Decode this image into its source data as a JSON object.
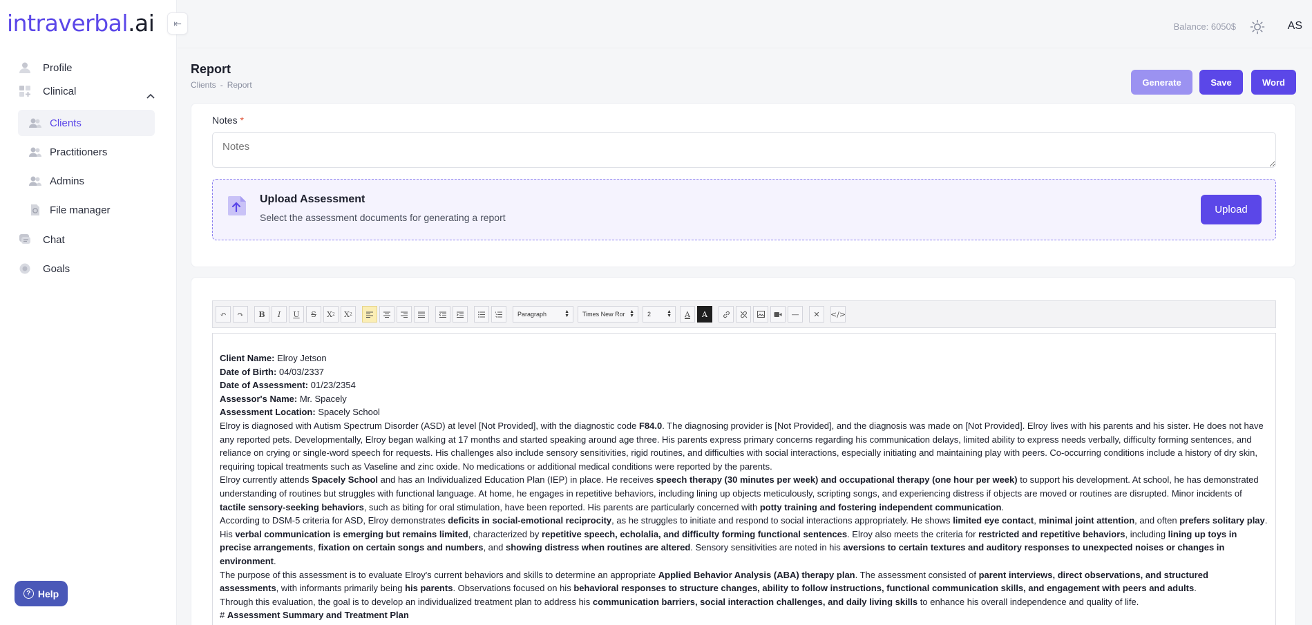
{
  "logo": {
    "main": "intraverbal",
    "suffix": ".ai"
  },
  "sidebar": {
    "collapse_glyph": "⇤",
    "profile": "Profile",
    "clinical": "Clinical",
    "clients": "Clients",
    "practitioners": "Practitioners",
    "admins": "Admins",
    "file_manager": "File manager",
    "chat": "Chat",
    "goals": "Goals",
    "help": "Help"
  },
  "topbar": {
    "balance": "Balance: 6050$",
    "initials": "AS",
    "theme_icon": "sun-icon"
  },
  "header": {
    "title": "Report",
    "breadcrumb": [
      "Clients",
      "-",
      "Report"
    ],
    "generate": "Generate",
    "save": "Save",
    "word": "Word"
  },
  "notes": {
    "label": "Notes",
    "required_mark": "*",
    "placeholder": "Notes",
    "value": ""
  },
  "upload": {
    "title": "Upload Assessment",
    "subtitle": "Select the assessment documents for generating a report",
    "button": "Upload"
  },
  "toolbar": {
    "block_format": "Paragraph",
    "font_family": "Times New Ror",
    "font_size": "2"
  },
  "document": {
    "client_name_label": "Client Name:",
    "client_name": "Elroy Jetson",
    "dob_label": "Date of Birth:",
    "dob": "04/03/2337",
    "doa_label": "Date of Assessment:",
    "doa": "01/23/2354",
    "assessor_label": "Assessor's Name:",
    "assessor": "Mr. Spacely",
    "location_label": "Assessment Location:",
    "location": "Spacely School",
    "p1": [
      {
        "t": "Elroy is diagnosed with Autism Spectrum Disorder (ASD) at level [Not Provided], with the diagnostic code ",
        "b": false
      },
      {
        "t": "F84.0",
        "b": true
      },
      {
        "t": ". The diagnosing provider is [Not Provided], and the diagnosis was made on [Not Provided]. Elroy lives with his parents and his sister. He does not have any reported pets. Developmentally, Elroy began walking at 17 months and started speaking around age three. His parents express primary concerns regarding his communication delays, limited ability to express needs verbally, difficulty forming sentences, and reliance on crying or single-word speech for requests. His challenges also include sensory sensitivities, rigid routines, and difficulties with social interactions, especially initiating and maintaining play with peers. Co-occurring conditions include a history of dry skin, requiring topical treatments such as Vaseline and zinc oxide. No medications or additional medical conditions were reported by the parents.",
        "b": false
      }
    ],
    "p2": [
      {
        "t": "Elroy currently attends ",
        "b": false
      },
      {
        "t": "Spacely School",
        "b": true
      },
      {
        "t": " and has an Individualized Education Plan (IEP) in place. He receives ",
        "b": false
      },
      {
        "t": "speech therapy (30 minutes per week) and occupational therapy (one hour per week)",
        "b": true
      },
      {
        "t": " to support his development. At school, he has demonstrated understanding of routines but struggles with functional language. At home, he engages in repetitive behaviors, including lining up objects meticulously, scripting songs, and experiencing distress if objects are moved or routines are disrupted. Minor incidents of ",
        "b": false
      },
      {
        "t": "tactile sensory-seeking behaviors",
        "b": true
      },
      {
        "t": ", such as biting for oral stimulation, have been reported. His parents are particularly concerned with ",
        "b": false
      },
      {
        "t": "potty training and fostering independent communication",
        "b": true
      },
      {
        "t": ".",
        "b": false
      }
    ],
    "p3": [
      {
        "t": "According to DSM-5 criteria for ASD, Elroy demonstrates ",
        "b": false
      },
      {
        "t": "deficits in social-emotional reciprocity",
        "b": true
      },
      {
        "t": ", as he struggles to initiate and respond to social interactions appropriately. He shows ",
        "b": false
      },
      {
        "t": "limited eye contact",
        "b": true
      },
      {
        "t": ", ",
        "b": false
      },
      {
        "t": "minimal joint attention",
        "b": true
      },
      {
        "t": ", and often ",
        "b": false
      },
      {
        "t": "prefers solitary play",
        "b": true
      },
      {
        "t": ". His ",
        "b": false
      },
      {
        "t": "verbal communication is emerging but remains limited",
        "b": true
      },
      {
        "t": ", characterized by ",
        "b": false
      },
      {
        "t": "repetitive speech, echolalia, and difficulty forming functional sentences",
        "b": true
      },
      {
        "t": ". Elroy also meets the criteria for ",
        "b": false
      },
      {
        "t": "restricted and repetitive behaviors",
        "b": true
      },
      {
        "t": ", including ",
        "b": false
      },
      {
        "t": "lining up toys in precise arrangements",
        "b": true
      },
      {
        "t": ", ",
        "b": false
      },
      {
        "t": "fixation on certain songs and numbers",
        "b": true
      },
      {
        "t": ", and ",
        "b": false
      },
      {
        "t": "showing distress when routines are altered",
        "b": true
      },
      {
        "t": ". Sensory sensitivities are noted in his ",
        "b": false
      },
      {
        "t": "aversions to certain textures and auditory responses to unexpected noises or changes in environment",
        "b": true
      },
      {
        "t": ".",
        "b": false
      }
    ],
    "p4": [
      {
        "t": "The purpose of this assessment is to evaluate Elroy's  current behaviors and skills to determine an appropriate ",
        "b": false
      },
      {
        "t": "Applied Behavior Analysis (ABA) therapy plan",
        "b": true
      },
      {
        "t": ". The assessment consisted of ",
        "b": false
      },
      {
        "t": "parent interviews, direct observations, and structured assessments",
        "b": true
      },
      {
        "t": ", with informants primarily being ",
        "b": false
      },
      {
        "t": "his parents",
        "b": true
      },
      {
        "t": ". Observations focused on his ",
        "b": false
      },
      {
        "t": "behavioral responses to structure changes, ability to follow instructions, functional communication skills, and engagement with peers and adults",
        "b": true
      },
      {
        "t": ".",
        "b": false
      }
    ],
    "p5": [
      {
        "t": "Through this evaluation, the goal is to develop an individualized treatment plan to address his ",
        "b": false
      },
      {
        "t": "communication barriers, social interaction challenges, and daily living skills",
        "b": true
      },
      {
        "t": " to enhance his overall independence and quality of life.",
        "b": false
      }
    ],
    "heading_prefix": "# ",
    "heading": "Assessment Summary and Treatment Plan"
  },
  "colors": {
    "accent": "#5b47e8",
    "accent_light": "#9b92f1",
    "help": "#4a58b8"
  }
}
